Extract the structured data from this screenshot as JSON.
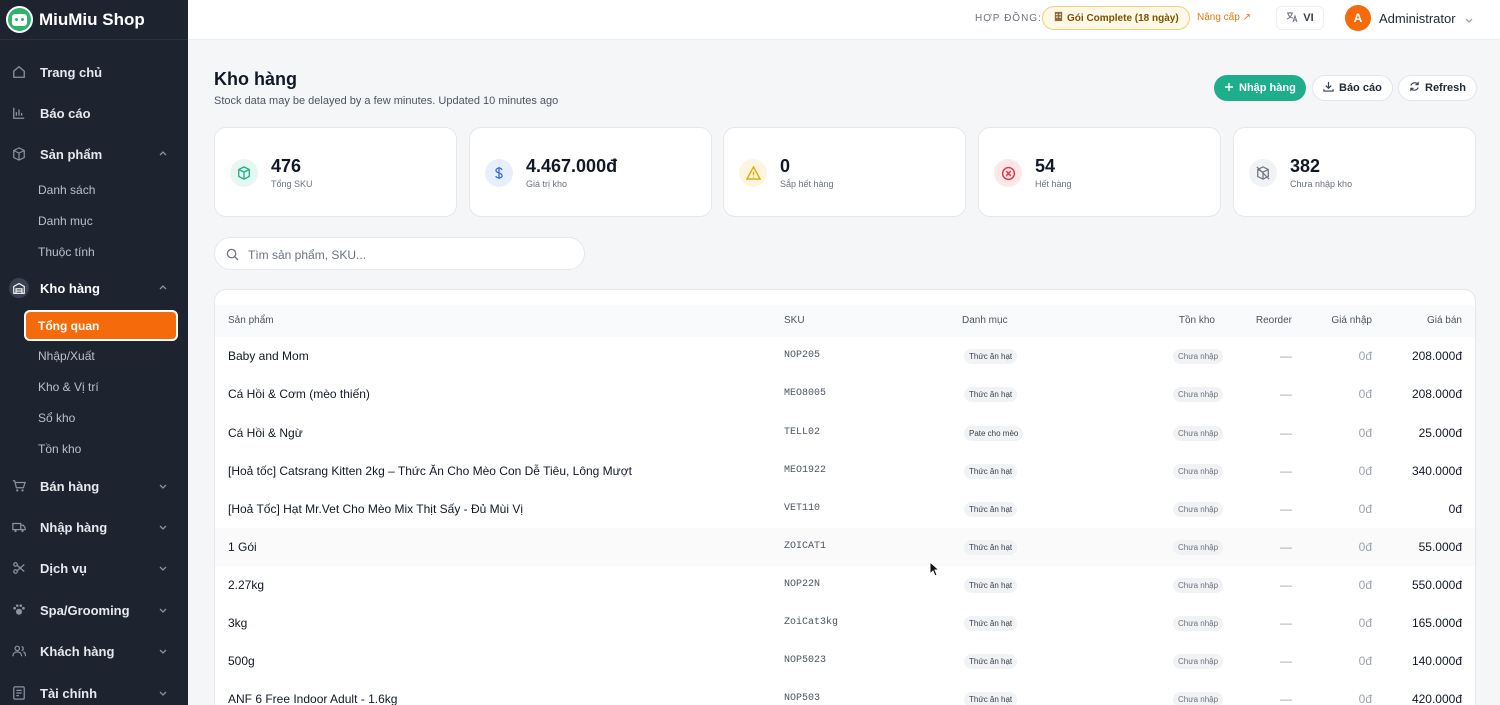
{
  "brand": {
    "name": "MiuMiu Shop"
  },
  "sidebar": {
    "items": [
      {
        "label": "Trang chủ",
        "icon": "home-icon"
      },
      {
        "label": "Báo cáo",
        "icon": "chart-icon"
      },
      {
        "label": "Sản phẩm",
        "icon": "box-icon",
        "expanded": true,
        "children": [
          "Danh sách",
          "Danh mục",
          "Thuộc tính"
        ]
      },
      {
        "label": "Kho hàng",
        "icon": "warehouse-icon",
        "expanded": true,
        "children": [
          "Tổng quan",
          "Nhập/Xuất",
          "Kho & Vị trí",
          "Sổ kho",
          "Tồn kho"
        ],
        "active_child": "Tổng quan"
      },
      {
        "label": "Bán hàng",
        "icon": "cart-icon"
      },
      {
        "label": "Nhập hàng",
        "icon": "truck-icon"
      },
      {
        "label": "Dịch vụ",
        "icon": "scissors-icon"
      },
      {
        "label": "Spa/Grooming",
        "icon": "paw-icon"
      },
      {
        "label": "Khách hàng",
        "icon": "users-icon"
      },
      {
        "label": "Tài chính",
        "icon": "wallet-icon"
      }
    ]
  },
  "topbar": {
    "contract_label": "HỢP ĐỒNG:",
    "plan": "Gói Complete (18 ngày)",
    "upgrade": "Nâng cấp ↗",
    "lang": "VI",
    "avatar_initial": "A",
    "user_name": "Administrator"
  },
  "page": {
    "title": "Kho hàng",
    "subtitle": "Stock data may be delayed by a few minutes. Updated 10 minutes ago",
    "buttons": {
      "import": "Nhập hàng",
      "report": "Báo cáo",
      "refresh": "Refresh"
    }
  },
  "stats": [
    {
      "value": "476",
      "label": "Tổng SKU",
      "color": "#1fae8c",
      "icon": "cube-icon"
    },
    {
      "value": "4.467.000đ",
      "label": "Giá trị kho",
      "color": "#3b6fd8",
      "icon": "dollar-icon"
    },
    {
      "value": "0",
      "label": "Sắp hết hàng",
      "color": "#e0a800",
      "icon": "warning-icon"
    },
    {
      "value": "54",
      "label": "Hết hàng",
      "color": "#e0323c",
      "icon": "x-circle-icon"
    },
    {
      "value": "382",
      "label": "Chưa nhập kho",
      "color": "#6b7280",
      "icon": "package-off-icon"
    }
  ],
  "search": {
    "placeholder": "Tìm sản phẩm, SKU..."
  },
  "table": {
    "headers": {
      "product": "Sản phẩm",
      "sku": "SKU",
      "category": "Danh mục",
      "stock": "Tồn kho",
      "reorder": "Reorder",
      "cost": "Giá nhập",
      "price": "Giá bán"
    },
    "rows": [
      {
        "name": "Baby and Mom",
        "sku": "NOP205",
        "category": "Thức ăn hạt",
        "stock": "Chưa nhập",
        "reorder": "—",
        "cost": "0đ",
        "price": "208.000đ"
      },
      {
        "name": "Cá Hồi & Cơm (mèo thiến)",
        "sku": "MEO8005",
        "category": "Thức ăn hạt",
        "stock": "Chưa nhập",
        "reorder": "—",
        "cost": "0đ",
        "price": "208.000đ"
      },
      {
        "name": "Cá Hồi & Ngừ",
        "sku": "TELL02",
        "category": "Pate cho mèo",
        "stock": "Chưa nhập",
        "reorder": "—",
        "cost": "0đ",
        "price": "25.000đ"
      },
      {
        "name": "[Hoả tốc] Catsrang Kitten 2kg – Thức Ăn Cho Mèo Con Dễ Tiêu, Lông Mượt",
        "sku": "MEO1922",
        "category": "Thức ăn hạt",
        "stock": "Chưa nhập",
        "reorder": "—",
        "cost": "0đ",
        "price": "340.000đ"
      },
      {
        "name": "[Hoả Tốc] Hạt Mr.Vet Cho Mèo Mix Thịt Sấy - Đủ Mùi Vị",
        "sku": "VET110",
        "category": "Thức ăn hạt",
        "stock": "Chưa nhập",
        "reorder": "—",
        "cost": "0đ",
        "price": "0đ"
      },
      {
        "name": "1 Gói",
        "sku": "ZOICAT1",
        "category": "Thức ăn hạt",
        "stock": "Chưa nhập",
        "reorder": "—",
        "cost": "0đ",
        "price": "55.000đ"
      },
      {
        "name": "2.27kg",
        "sku": "NOP22N",
        "category": "Thức ăn hạt",
        "stock": "Chưa nhập",
        "reorder": "—",
        "cost": "0đ",
        "price": "550.000đ"
      },
      {
        "name": "3kg",
        "sku": "ZoiCat3kg",
        "category": "Thức ăn hạt",
        "stock": "Chưa nhập",
        "reorder": "—",
        "cost": "0đ",
        "price": "165.000đ"
      },
      {
        "name": "500g",
        "sku": "NOP5023",
        "category": "Thức ăn hạt",
        "stock": "Chưa nhập",
        "reorder": "—",
        "cost": "0đ",
        "price": "140.000đ"
      },
      {
        "name": "ANF 6 Free Indoor Adult - 1.6kg",
        "sku": "NOP503",
        "category": "Thức ăn hạt",
        "stock": "Chưa nhập",
        "reorder": "—",
        "cost": "0đ",
        "price": "420.000đ"
      }
    ]
  }
}
